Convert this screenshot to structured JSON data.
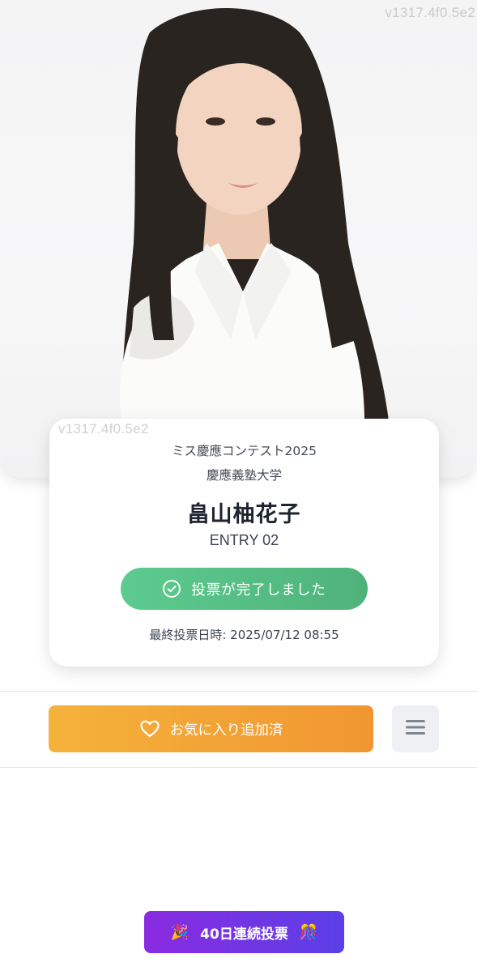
{
  "watermark": "v1317.4f0.5e2",
  "profile": {
    "contest": "ミス慶應コンテスト2025",
    "university": "慶應義塾大学",
    "name": "畠山柚花子",
    "entry": "ENTRY 02"
  },
  "vote": {
    "status_label": "投票が完了しました",
    "last_vote": "最終投票日時: 2025/07/12 08:55"
  },
  "actions": {
    "favorite_label": "お気に入り追加済",
    "menu_icon": "hamburger-icon"
  },
  "streak": {
    "label": "40日連続投票",
    "left_emoji": "🎉",
    "right_emoji": "🎊"
  },
  "colors": {
    "vote_green": "#54bd83",
    "favorite_orange": "#f2a436",
    "streak_purple": "#7436e4"
  }
}
